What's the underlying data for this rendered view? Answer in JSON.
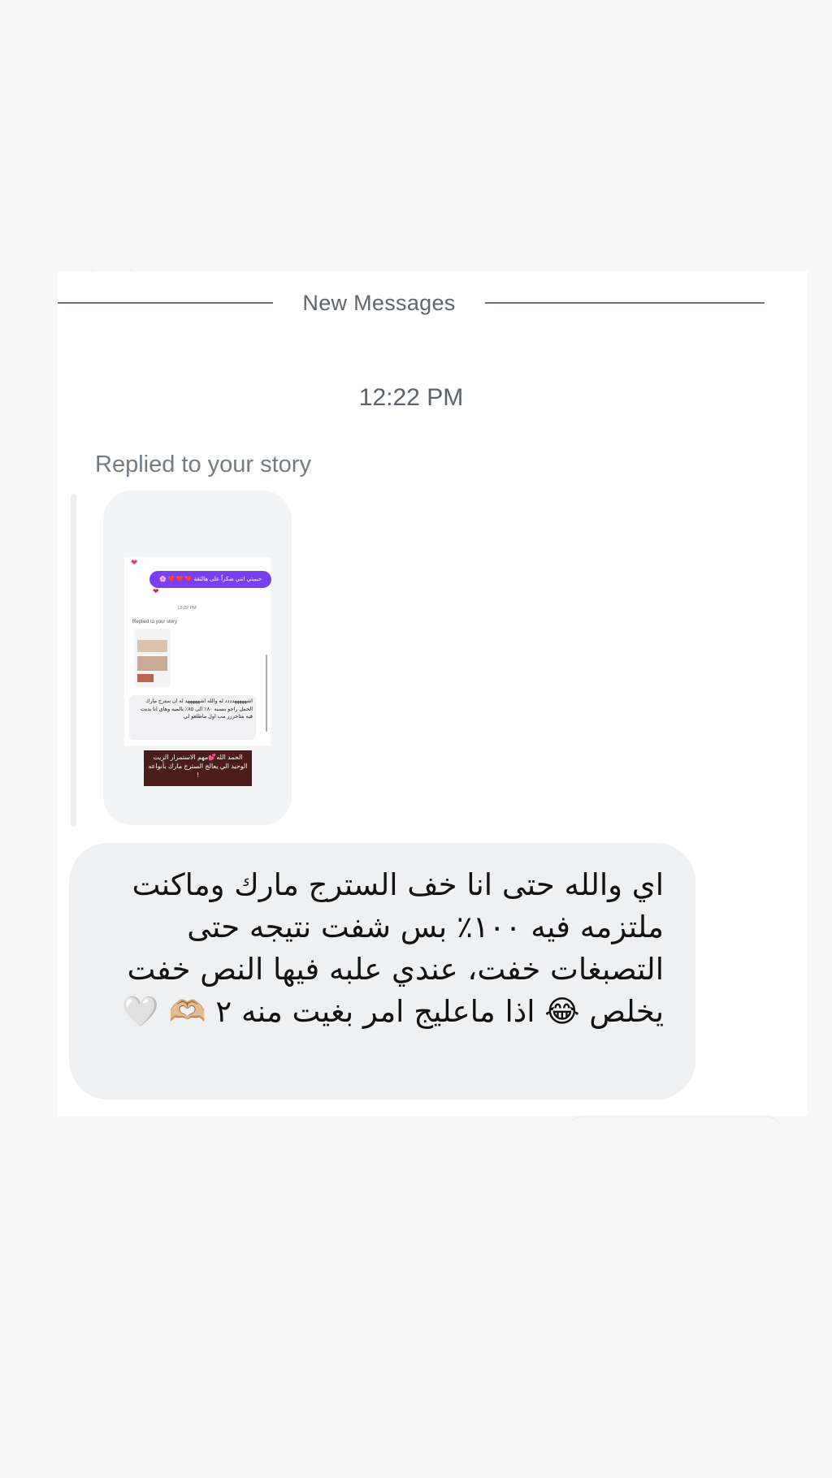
{
  "divider": {
    "label": "New Messages"
  },
  "timestamp": "12:22 PM",
  "reply": {
    "label": "Replied to your story"
  },
  "story_preview": {
    "bubble_text": "حبيبتي انتي شكراً على هالثقة ❤️ ❤️ ❤️ 🌸",
    "time": "12:22 PM",
    "replied_label": "Replied to your story",
    "message_text": "اشهههههدددد له والله اشهههههد له ان سترج مارك الحمل راجو بنسبه ٨٠٪ الى ٨٥٪ بالميه وهاي انا بديت فيه متاخررر مب اول ماطلعو لي",
    "caption": "الحمد الله💕مهم الاستمرار الزيت الوحيد الي يعالج السترج مارك بأنواعه !"
  },
  "message": {
    "text": "اي والله حتى انا خف السترج مارك وماكنت ملتزمه فيه ١٠٠٪ بس شفت نتيجه حتى التصبغات خفت، عندي علبه فيها النص خفت يخلص 😂 اذا ماعليج امر بغيت منه ٢ 🫶🏼 🤍"
  }
}
